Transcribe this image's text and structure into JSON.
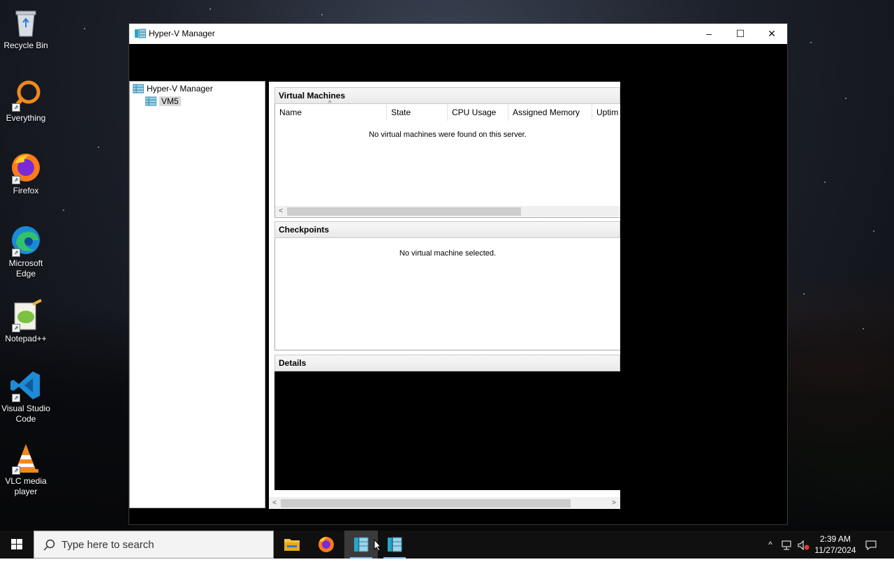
{
  "desktop": {
    "icons": [
      {
        "label": "Recycle Bin"
      },
      {
        "label": "Everything"
      },
      {
        "label": "Firefox"
      },
      {
        "label": "Microsoft Edge"
      },
      {
        "label": "Notepad++"
      },
      {
        "label": "Visual Studio Code"
      },
      {
        "label": "VLC media player"
      }
    ]
  },
  "window": {
    "title": "Hyper-V Manager",
    "controls": {
      "minimize": "–",
      "maximize": "☐",
      "close": "✕"
    }
  },
  "tree": {
    "root": "Hyper-V Manager",
    "child": "VM5"
  },
  "virtual_machines": {
    "header": "Virtual Machines",
    "columns": [
      "Name",
      "State",
      "CPU Usage",
      "Assigned Memory",
      "Uptim"
    ],
    "sort_indicator": "^",
    "empty_message": "No virtual machines were found on this server."
  },
  "checkpoints": {
    "header": "Checkpoints",
    "empty_message": "No virtual machine selected."
  },
  "details": {
    "header": "Details"
  },
  "taskbar": {
    "search_placeholder": "Type here to search",
    "apps": [
      "File Explorer",
      "Firefox",
      "Hyper-V Manager",
      "Hyper-V Manager"
    ],
    "time": "2:39 AM",
    "date": "11/27/2024"
  },
  "colors": {
    "accent": "#7fb6e8",
    "taskbar": "#101010",
    "pane_header": "#e9e9e9"
  }
}
